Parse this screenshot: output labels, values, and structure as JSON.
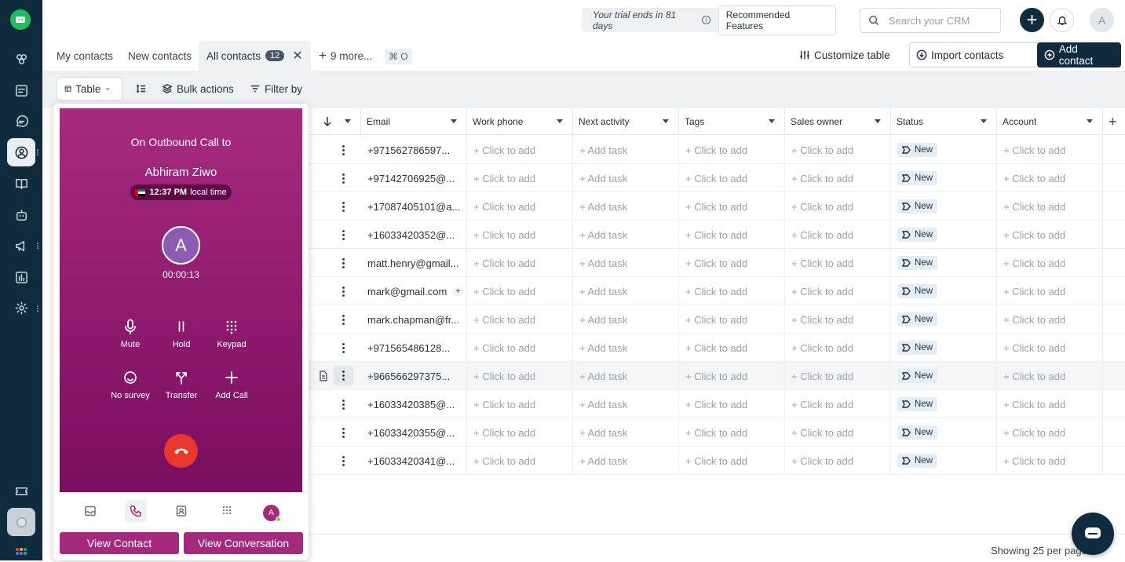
{
  "topbar": {
    "trial_text": "Your trial ends in 81 days",
    "recommended_label": "Recommended Features",
    "search_placeholder": "Search your CRM",
    "avatar_initial": "A"
  },
  "tabs": [
    {
      "label": "My contacts"
    },
    {
      "label": "New contacts"
    },
    {
      "label": "All contacts",
      "count": "12"
    },
    {
      "label": "9 more..."
    }
  ],
  "shortcut": "⌘ O",
  "actions": {
    "customize": "Customize table",
    "import": "Import contacts",
    "add": "Add contact"
  },
  "toolbar": {
    "view": "Table",
    "bulk": "Bulk actions",
    "filter": "Filter by"
  },
  "columns": [
    "Email",
    "Work phone",
    "Next activity",
    "Tags",
    "Sales owner",
    "Status",
    "Account"
  ],
  "rows": [
    {
      "email": "+971562786597...",
      "phone": "+ Click to add",
      "activity": "+ Add task",
      "tags": "+ Click to add",
      "owner": "+ Click to add",
      "status": "New",
      "account": "+ Click to add"
    },
    {
      "email": "+97142706925@...",
      "phone": "+ Click to add",
      "activity": "+ Add task",
      "tags": "+ Click to add",
      "owner": "+ Click to add",
      "status": "New",
      "account": "+ Click to add"
    },
    {
      "email": "+17087405101@a...",
      "phone": "+ Click to add",
      "activity": "+ Add task",
      "tags": "+ Click to add",
      "owner": "+ Click to add",
      "status": "New",
      "account": "+ Click to add"
    },
    {
      "email": "+16033420352@...",
      "phone": "+ Click to add",
      "activity": "+ Add task",
      "tags": "+ Click to add",
      "owner": "+ Click to add",
      "status": "New",
      "account": "+ Click to add"
    },
    {
      "email": "matt.henry@gmail...",
      "phone": "+ Click to add",
      "activity": "+ Add task",
      "tags": "+ Click to add",
      "owner": "+ Click to add",
      "status": "New",
      "account": "+ Click to add"
    },
    {
      "email": "mark@gmail.com",
      "phone": "+ Click to add",
      "activity": "+ Add task",
      "tags": "+ Click to add",
      "owner": "+ Click to add",
      "status": "New",
      "account": "+ Click to add"
    },
    {
      "email": "mark.chapman@fr...",
      "phone": "+ Click to add",
      "activity": "+ Add task",
      "tags": "+ Click to add",
      "owner": "+ Click to add",
      "status": "New",
      "account": "+ Click to add"
    },
    {
      "email": "+971565486128...",
      "phone": "+ Click to add",
      "activity": "+ Add task",
      "tags": "+ Click to add",
      "owner": "+ Click to add",
      "status": "New",
      "account": "+ Click to add"
    },
    {
      "email": "+966566297375...",
      "phone": "+ Click to add",
      "activity": "+ Add task",
      "tags": "+ Click to add",
      "owner": "+ Click to add",
      "status": "New",
      "account": "+ Click to add"
    },
    {
      "email": "+16033420385@...",
      "phone": "+ Click to add",
      "activity": "+ Add task",
      "tags": "+ Click to add",
      "owner": "+ Click to add",
      "status": "New",
      "account": "+ Click to add"
    },
    {
      "email": "+16033420355@...",
      "phone": "+ Click to add",
      "activity": "+ Add task",
      "tags": "+ Click to add",
      "owner": "+ Click to add",
      "status": "New",
      "account": "+ Click to add"
    },
    {
      "email": "+16033420341@...",
      "phone": "+ Click to add",
      "activity": "+ Add task",
      "tags": "+ Click to add",
      "owner": "+ Click to add",
      "status": "New",
      "account": "+ Click to add"
    }
  ],
  "footer": {
    "showing": "Showing 25 per page"
  },
  "dialer": {
    "heading": "On Outbound Call to",
    "contact_name": "Abhiram Ziwo",
    "local_time": "12:37 PM",
    "local_time_suffix": "local time",
    "avatar_initial": "A",
    "timer": "00:00:13",
    "controls": [
      "Mute",
      "Hold",
      "Keypad",
      "No survey",
      "Transfer",
      "Add Call"
    ],
    "agent_initial": "A",
    "view_contact": "View Contact",
    "view_conversation": "View Conversation",
    "accent_color": "#a52a7e"
  },
  "colors": {
    "sidebar": "#0f2b3d",
    "hangup": "#e8372b",
    "status_chip": "#e4eef8"
  }
}
